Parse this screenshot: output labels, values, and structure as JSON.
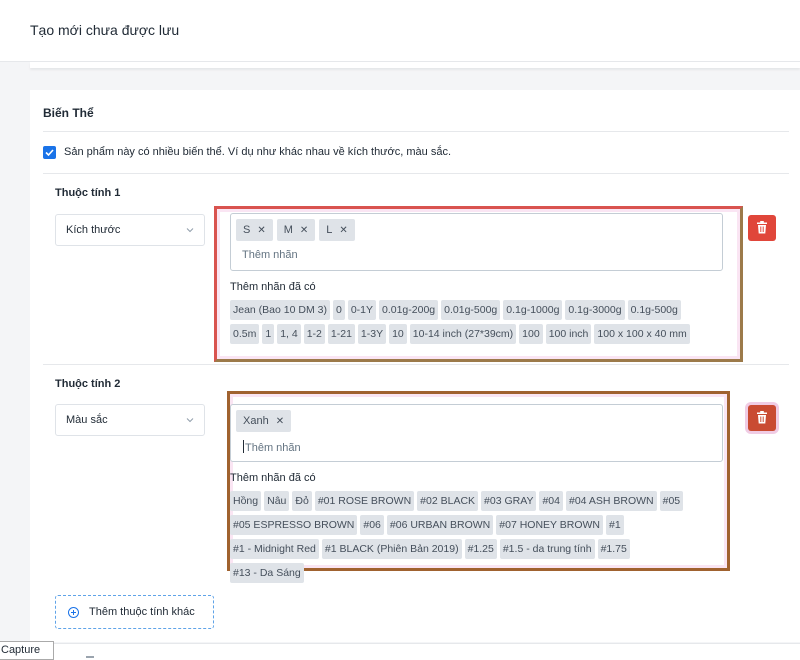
{
  "header": {
    "title": "Tạo mới chưa được lưu"
  },
  "variants": {
    "title": "Biến Thể",
    "checkbox_label": "Sản phẩm này có nhiều biến thể. Ví dụ như khác nhau về kích thước, màu sắc.",
    "checkbox_checked": true,
    "attributes": [
      {
        "label": "Thuộc tính 1",
        "select_value": "Kích thước",
        "tags": [
          "S",
          "M",
          "L"
        ],
        "placeholder": "Thêm nhãn",
        "suggest_title": "Thêm nhãn đã có",
        "suggestions": [
          "Jean (Bao 10 DM 3)",
          "0",
          "0-1Y",
          "0.01g-200g",
          "0.01g-500g",
          "0.1g-1000g",
          "0.1g-3000g",
          "0.1g-500g",
          "0.5m",
          "1",
          "1, 4",
          "1-2",
          "1-21",
          "1-3Y",
          "10",
          "10-14 inch (27*39cm)",
          "100",
          "100 inch",
          "100 x 100 x 40 mm"
        ]
      },
      {
        "label": "Thuộc tính 2",
        "select_value": "Màu sắc",
        "tags": [
          "Xanh"
        ],
        "placeholder": "Thêm nhãn",
        "suggest_title": "Thêm nhãn đã có",
        "suggestions": [
          "Hồng",
          "Nâu",
          "Đỏ",
          "#01 ROSE BROWN",
          "#02 BLACK",
          "#03 GRAY",
          "#04",
          "#04 ASH BROWN",
          "#05",
          "#05 ESPRESSO BROWN",
          "#06",
          "#06 URBAN BROWN",
          "#07 HONEY BROWN",
          "#1",
          "#1 - Midnight Red",
          "#1 BLACK (Phiên Bản 2019)",
          "#1.25",
          "#1.5 - da trung tính",
          "#1.75",
          "#13 - Da Sáng"
        ]
      }
    ],
    "add_attribute_label": "Thêm thuộc tính khác"
  },
  "overlay": {
    "capture_label": "Capture"
  },
  "colors": {
    "accent": "#1a73e8",
    "delete": "#e0463a",
    "chip": "#dfe3e8"
  }
}
